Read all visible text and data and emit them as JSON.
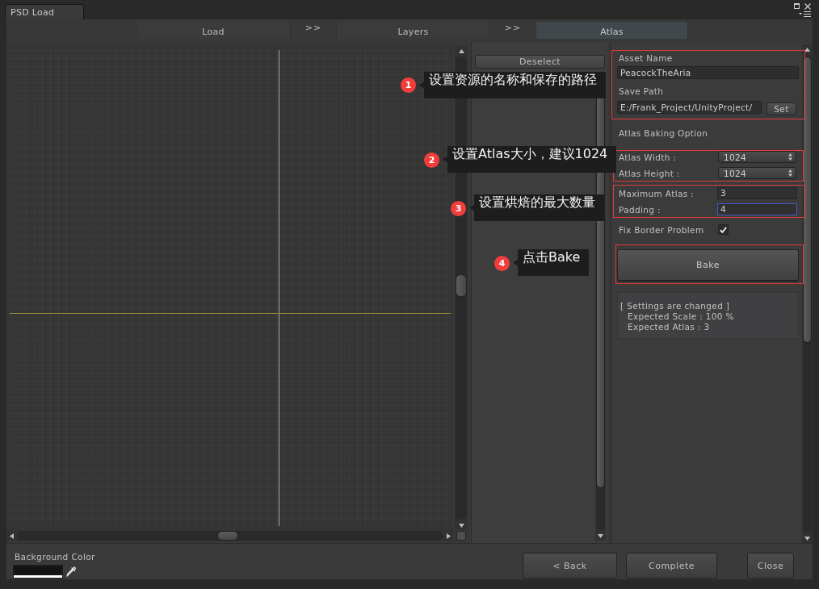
{
  "window": {
    "title": "PSD Load"
  },
  "steps": [
    {
      "label": "Load",
      "selected": false
    },
    {
      "label": "Layers",
      "selected": false
    },
    {
      "label": "Atlas",
      "selected": true
    }
  ],
  "step_separators": [
    ">>",
    ">>"
  ],
  "layer_panel": {
    "deselect_button": "Deselect"
  },
  "atlas_panel": {
    "asset_name": {
      "label": "Asset Name",
      "value": "PeacockTheAria"
    },
    "save_path": {
      "label": "Save Path",
      "value": "E:/Frank_Project/UnityProject/",
      "button": "Set"
    },
    "section_title": "Atlas Baking Option",
    "fields": [
      {
        "kind": "dropdown",
        "label": "Atlas Width :",
        "value": "1024"
      },
      {
        "kind": "dropdown",
        "label": "Atlas Height :",
        "value": "1024"
      },
      {
        "kind": "number",
        "label": "Maximum Atlas :",
        "value": "3",
        "focused": false
      },
      {
        "kind": "number",
        "label": "Padding :",
        "value": "4",
        "focused": true
      },
      {
        "kind": "checkbox",
        "label": "Fix Border Problem",
        "checked": true
      }
    ],
    "bake_button": "Bake",
    "status_lines": [
      "[ Settings are changed ]",
      "Expected Scale : 100 %",
      "Expected Atlas : 3"
    ]
  },
  "footer": {
    "background_color": {
      "label": "Background Color",
      "color": "#141414"
    },
    "buttons": [
      "< Back",
      "Complete",
      "Close"
    ]
  },
  "annotations": [
    {
      "number": "1",
      "text": "设置资源的名称和保存的路径"
    },
    {
      "number": "2",
      "text": "设置Atlas大小，建议1024"
    },
    {
      "number": "3",
      "text": "设置烘焙的最大数量"
    },
    {
      "number": "4",
      "text": "点击Bake"
    }
  ]
}
